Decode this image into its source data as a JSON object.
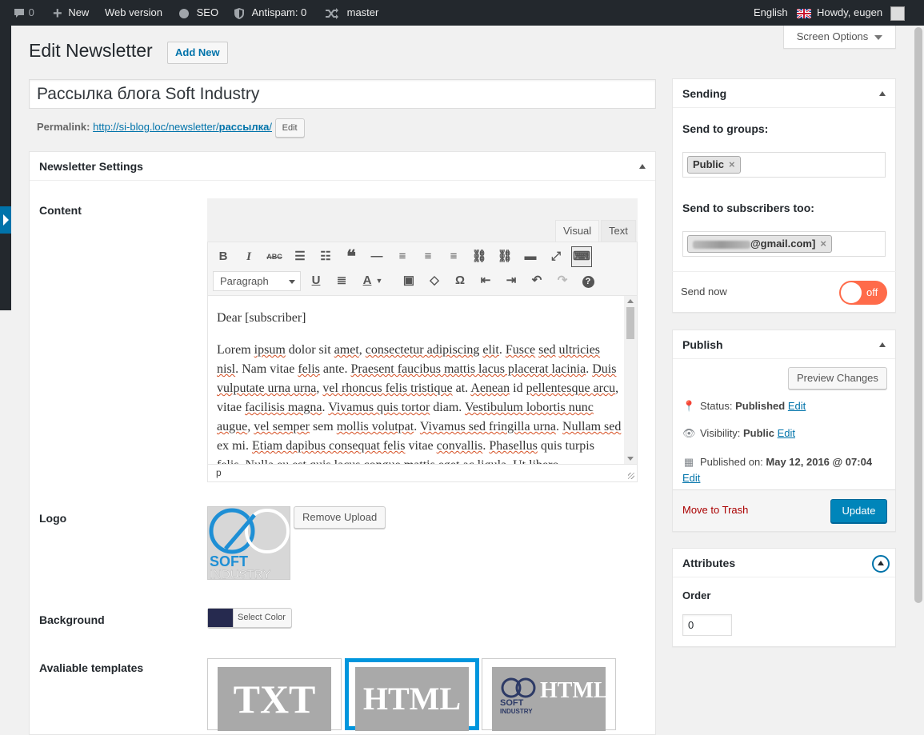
{
  "adminbar": {
    "comments_count": "0",
    "new_label": "New",
    "web_version": "Web version",
    "seo": "SEO",
    "antispam": "Antispam: 0",
    "branch": "master",
    "language": "English",
    "howdy": "Howdy, eugen"
  },
  "screen_options": "Screen Options",
  "page": {
    "title": "Edit Newsletter",
    "add_new": "Add New",
    "post_title": "Рассылка блога Soft Industry",
    "permalink_label": "Permalink:",
    "permalink_base": "http://si-blog.loc/newsletter/",
    "permalink_slug": "рассылка",
    "permalink_tail": "/",
    "permalink_edit": "Edit"
  },
  "settings": {
    "box_title": "Newsletter Settings",
    "content_label": "Content",
    "tab_visual": "Visual",
    "tab_text": "Text",
    "format_select": "Paragraph",
    "editor_p1": "Dear [subscriber]",
    "editor_status": "p",
    "logo_label": "Logo",
    "logo_text_top": "SOFT",
    "logo_text_bottom": "INDUSTRY",
    "remove_upload": "Remove Upload",
    "background_label": "Background",
    "background_color": "#262a4f",
    "select_color": "Select Color",
    "templates_label": "Avaliable templates",
    "templates": [
      {
        "label": "TXT"
      },
      {
        "label": "HTML"
      },
      {
        "label": "HTML",
        "logo_top": "SOFT",
        "logo_bottom": "INDUSTRY"
      }
    ]
  },
  "sending": {
    "title": "Sending",
    "groups_label": "Send to groups:",
    "group_token": "Public",
    "subscribers_label": "Send to subscribers too:",
    "subscriber_token_tail": "@gmail.com]",
    "send_now_label": "Send now",
    "send_now_state": "off"
  },
  "publish": {
    "title": "Publish",
    "preview": "Preview Changes",
    "status_label": "Status:",
    "status_value": "Published",
    "visibility_label": "Visibility:",
    "visibility_value": "Public",
    "published_label": "Published on:",
    "published_value": "May 12, 2016 @ 07:04",
    "edit": "Edit",
    "trash": "Move to Trash",
    "update": "Update"
  },
  "attributes": {
    "title": "Attributes",
    "order_label": "Order",
    "order_value": "0"
  }
}
